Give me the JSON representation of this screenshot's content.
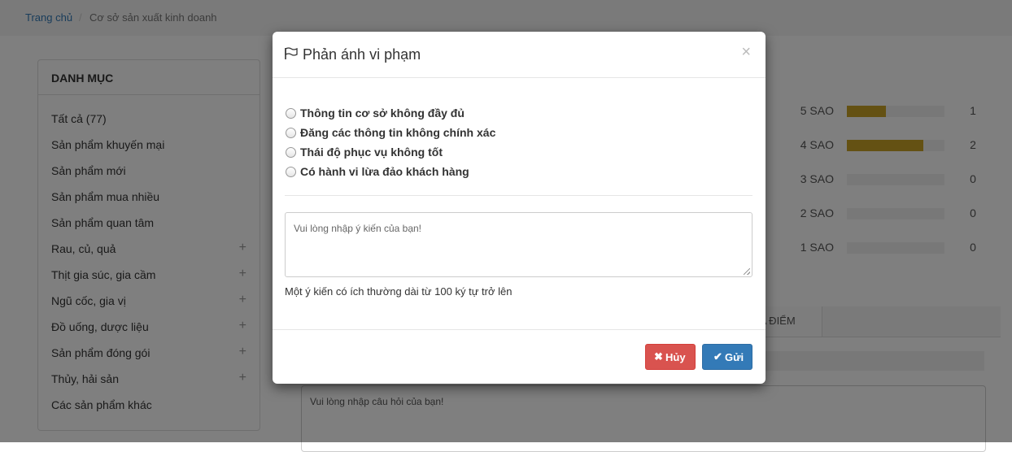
{
  "breadcrumb": {
    "home": "Trang chủ",
    "separator": "/",
    "current": "Cơ sở sản xuất kinh doanh"
  },
  "sidebar": {
    "title": "DANH MỤC",
    "items": [
      {
        "label": "Tất cả (77)",
        "expand": ""
      },
      {
        "label": "Sản phẩm khuyến mại",
        "expand": ""
      },
      {
        "label": "Sản phẩm mới",
        "expand": ""
      },
      {
        "label": "Sản phẩm mua nhiều",
        "expand": ""
      },
      {
        "label": "Sản phẩm quan tâm",
        "expand": ""
      },
      {
        "label": "Rau, củ, quả",
        "expand": "+"
      },
      {
        "label": "Thịt gia súc, gia cầm",
        "expand": "+"
      },
      {
        "label": "Ngũ cốc, gia vị",
        "expand": "+"
      },
      {
        "label": "Đồ uống, dược liệu",
        "expand": "+"
      },
      {
        "label": "Sản phẩm đóng gói",
        "expand": "+"
      },
      {
        "label": "Thủy, hải sản",
        "expand": "+"
      },
      {
        "label": "Các sản phẩm khác",
        "expand": ""
      }
    ]
  },
  "ratings": [
    {
      "label": "5 SAO",
      "count": "1",
      "fraction": 0.4
    },
    {
      "label": "4 SAO",
      "count": "2",
      "fraction": 0.78
    },
    {
      "label": "3 SAO",
      "count": "0",
      "fraction": 0
    },
    {
      "label": "2 SAO",
      "count": "0",
      "fraction": 0
    },
    {
      "label": "1 SAO",
      "count": "0",
      "fraction": 0
    }
  ],
  "tabs": {
    "partial_label": "IA ĐIỂM"
  },
  "question_placeholder": "Vui lòng nhập câu hỏi của bạn!",
  "modal": {
    "title": "Phản ánh vi phạm",
    "title_icon": "flag-icon",
    "close_label": "×",
    "options": [
      "Thông tin cơ sở không đầy đủ",
      "Đăng các thông tin không chính xác",
      "Thái độ phục vụ không tốt",
      "Có hành vi lừa đảo khách hàng"
    ],
    "feedback_placeholder": "Vui lòng nhập ý kiến của bạn!",
    "hint": "Một ý kiến có ích thường dài từ 100 ký tự trở lên",
    "cancel_icon": "✖",
    "cancel_label": "Hủy",
    "send_icon": "✔",
    "send_label": "Gửi"
  },
  "colors": {
    "accent": "#337ab7",
    "danger": "#d9534f",
    "rating_fill": "#c9a227",
    "overlay": "rgba(0,0,0,0.5)"
  }
}
